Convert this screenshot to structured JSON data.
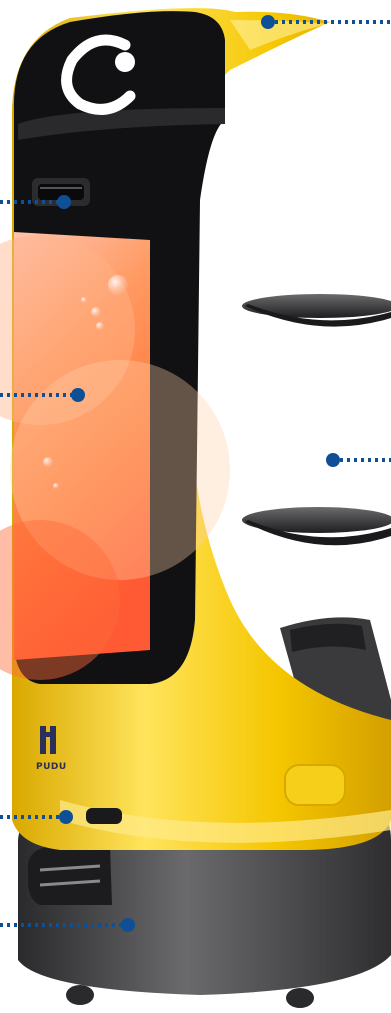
{
  "brand": {
    "logo_text": "PUDU",
    "logo_color": "#2b2f5c"
  },
  "colors": {
    "body_yellow": "#f2c400",
    "body_yellow_light": "#ffe25a",
    "shell_black": "#121212",
    "base_gray": "#4a4a4c",
    "tray_gray": "#3a3a3c",
    "callout_dot": "#0f4f96",
    "screen_orange": "#ff7a3d",
    "screen_pink": "#ffb7a6"
  },
  "callouts": [
    {
      "id": "head-top",
      "icon": "dot-marker"
    },
    {
      "id": "camera-sensor",
      "icon": "dot-marker"
    },
    {
      "id": "display-screen",
      "icon": "dot-marker"
    },
    {
      "id": "trays",
      "icon": "dot-marker"
    },
    {
      "id": "front-sensor",
      "icon": "dot-marker"
    },
    {
      "id": "chassis-base",
      "icon": "dot-marker"
    }
  ]
}
